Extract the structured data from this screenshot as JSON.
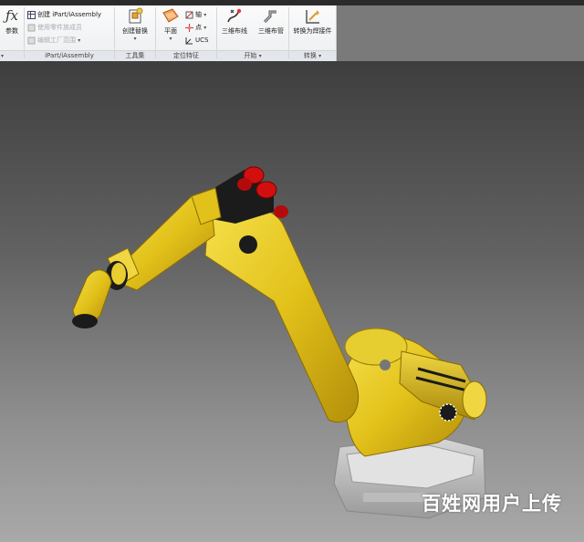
{
  "ribbon": {
    "parameters": {
      "label": "参数"
    },
    "iparts": {
      "create": "创建 iPart/iAssembly",
      "use_member": "使用零件族成员",
      "edit_factory": "编辑工厂范围",
      "title": "iPart/iAssembly"
    },
    "toolset": {
      "create_substitute": "创建替换",
      "title": "工具集"
    },
    "work_features": {
      "plane": "平面",
      "axis": "轴",
      "point": "点",
      "ucs": "UCS",
      "title": "定位特征"
    },
    "begin": {
      "route_3d": "三维布线",
      "tube_3d": "三维布管",
      "title": "开始"
    },
    "convert": {
      "to_weldment": "转换为焊接件",
      "title": "转换"
    }
  },
  "watermark": "百姓网用户上传",
  "colors": {
    "robot_yellow": "#e7c81c",
    "robot_dark": "#1b1b1b",
    "cap_red": "#d10f0f",
    "base_gray": "#c8c8c8"
  }
}
